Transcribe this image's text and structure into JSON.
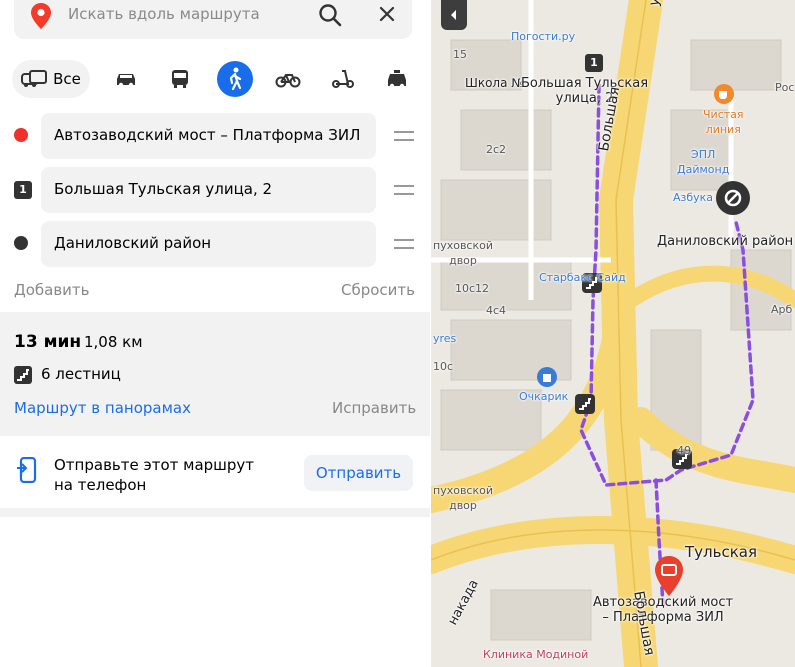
{
  "search": {
    "placeholder": "Искать вдоль маршрута"
  },
  "modes": {
    "all_label": "Все"
  },
  "stops": [
    {
      "label": "Автозаводский мост – Платформа ЗИЛ"
    },
    {
      "label": "Большая Тульская улица, 2",
      "badge": "1"
    },
    {
      "label": "Даниловский район"
    }
  ],
  "actions": {
    "add": "Добавить",
    "reset": "Сбросить"
  },
  "route": {
    "time": "13 мин",
    "distance": "1,08 км",
    "stairs": "6 лестниц",
    "panorama_link": "Маршрут в панорамах",
    "fix_link": "Исправить"
  },
  "send": {
    "text_line1": "Отправьте этот маршрут",
    "text_line2": "на телефон",
    "button": "Отправить"
  },
  "map": {
    "labels": {
      "pogosti": "Погости.ру",
      "school": "Школа №",
      "b_tulskaya_l1": "Большая Тульская",
      "b_tulskaya_l2": "улица, 2",
      "chistaya_l1": "Чистая",
      "chistaya_l2": "линия",
      "epl_l1": "ЭПЛ",
      "epl_l2": "Даймонд",
      "azbuka": "Азбука",
      "danilovsky": "Даниловский район",
      "starbucks": "Старбакс",
      "said": "Сайд",
      "ochkarik": "Очкарик",
      "tulskaya_street": "Тульская",
      "street_vert": "Большая",
      "end_l1": "Автозаводский мост",
      "end_l2": "– Платформа ЗИЛ",
      "klinika": "Клиника Модиной",
      "ves": "Рос",
      "arb": "Арб",
      "nakada": "накада",
      "dvor1_l1": "пуховской",
      "dvor1_l2": "двор",
      "dvor2_l1": "пуховской",
      "dvor2_l2": "двор",
      "ulitsa_top": "ул",
      "yres": "yres",
      "b15": "15",
      "b2c2": "2с2",
      "b10c12": "10с12",
      "b4c4": "4с4",
      "b10c": "10с",
      "b49": "49"
    },
    "colors": {
      "route": "#8a4ee0",
      "road": "#f7d774",
      "end_pin": "#e8402c"
    }
  }
}
